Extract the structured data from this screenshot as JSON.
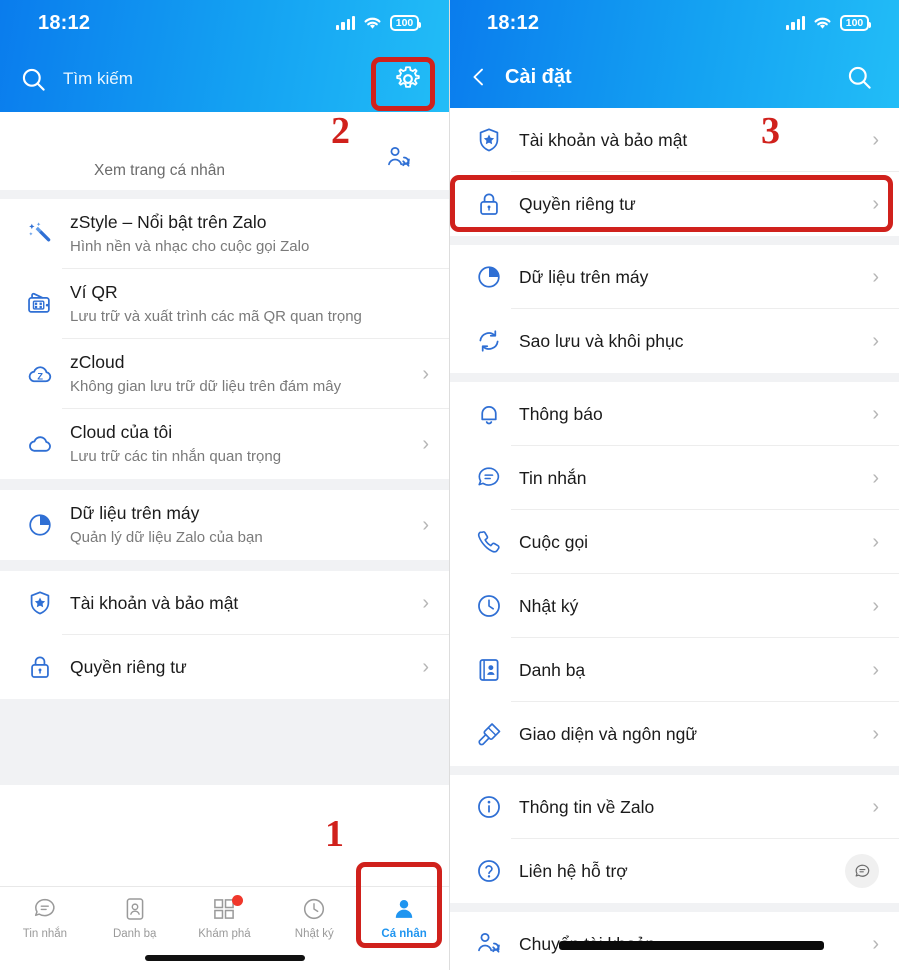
{
  "status_bar": {
    "time": "18:12",
    "battery": "100",
    "signal_icon": "signal-bars-icon",
    "wifi_icon": "wifi-icon"
  },
  "left_screen": {
    "search": {
      "placeholder": "Tìm kiếm",
      "search_icon": "search-icon",
      "settings_icon": "gear-icon"
    },
    "profile": {
      "subtitle": "Xem trang cá nhân",
      "switch_account_icon": "switch-account-icon"
    },
    "sections": [
      {
        "items": [
          {
            "icon": "magic-wand-icon",
            "title": "zStyle – Nổi bật trên Zalo",
            "subtitle": "Hình nền và nhạc cho cuộc gọi Zalo",
            "chevron": false
          },
          {
            "icon": "qr-wallet-icon",
            "title": "Ví QR",
            "subtitle": "Lưu trữ và xuất trình các mã QR quan trọng",
            "chevron": false
          },
          {
            "icon": "zcloud-icon",
            "title": "zCloud",
            "subtitle": "Không gian lưu trữ dữ liệu trên đám mây",
            "chevron": true
          },
          {
            "icon": "cloud-icon",
            "title": "Cloud của tôi",
            "subtitle": "Lưu trữ các tin nhắn quan trọng",
            "chevron": true
          }
        ]
      },
      {
        "items": [
          {
            "icon": "pie-chart-icon",
            "title": "Dữ liệu trên máy",
            "subtitle": "Quản lý dữ liệu Zalo của bạn",
            "chevron": true
          }
        ]
      },
      {
        "items": [
          {
            "icon": "shield-star-icon",
            "title": "Tài khoản và bảo mật",
            "subtitle": "",
            "chevron": true
          },
          {
            "icon": "lock-icon",
            "title": "Quyền riêng tư",
            "subtitle": "",
            "chevron": true
          }
        ]
      }
    ],
    "tabs": [
      {
        "icon": "chat-bubble-icon",
        "label": "Tin nhắn",
        "active": false,
        "badge": false
      },
      {
        "icon": "contacts-card-icon",
        "label": "Danh bạ",
        "active": false,
        "badge": false
      },
      {
        "icon": "grid-squares-icon",
        "label": "Khám phá",
        "active": false,
        "badge": true
      },
      {
        "icon": "clock-icon",
        "label": "Nhật ký",
        "active": false,
        "badge": false
      },
      {
        "icon": "person-icon",
        "label": "Cá nhân",
        "active": true,
        "badge": false
      }
    ]
  },
  "right_screen": {
    "header": {
      "back_icon": "chevron-left-icon",
      "title": "Cài đặt",
      "search_icon": "search-icon"
    },
    "sections": [
      {
        "items": [
          {
            "icon": "shield-star-icon",
            "title": "Tài khoản và bảo mật",
            "chevron": true
          },
          {
            "icon": "lock-icon",
            "title": "Quyền riêng tư",
            "chevron": true
          }
        ]
      },
      {
        "items": [
          {
            "icon": "pie-chart-icon",
            "title": "Dữ liệu trên máy",
            "chevron": true
          },
          {
            "icon": "sync-icon",
            "title": "Sao lưu và khôi phục",
            "chevron": true
          }
        ]
      },
      {
        "items": [
          {
            "icon": "bell-icon",
            "title": "Thông báo",
            "chevron": true
          },
          {
            "icon": "chat-bubble-icon",
            "title": "Tin nhắn",
            "chevron": true
          },
          {
            "icon": "phone-icon",
            "title": "Cuộc gọi",
            "chevron": true
          },
          {
            "icon": "clock-icon",
            "title": "Nhật ký",
            "chevron": true
          },
          {
            "icon": "contacts-book-icon",
            "title": "Danh bạ",
            "chevron": true
          },
          {
            "icon": "paint-roller-icon",
            "title": "Giao diện và ngôn ngữ",
            "chevron": true
          }
        ]
      },
      {
        "items": [
          {
            "icon": "info-circle-icon",
            "title": "Thông tin về Zalo",
            "chevron": true
          },
          {
            "icon": "question-circle-icon",
            "title": "Liên hệ hỗ trợ",
            "chevron": false,
            "trailing": "chat-bubble-round-icon"
          }
        ]
      },
      {
        "items": [
          {
            "icon": "switch-account-icon",
            "title": "Chuyển tài khoản",
            "chevron": true
          }
        ]
      }
    ]
  },
  "annotations": [
    {
      "number": "1",
      "target": "profile-tab"
    },
    {
      "number": "2",
      "target": "settings-gear"
    },
    {
      "number": "3",
      "target": "privacy-row"
    }
  ],
  "colors": {
    "header_gradient_start": "#0a7ced",
    "header_gradient_end": "#22bdf7",
    "accent_blue": "#1f95f0",
    "icon_blue": "#2d6fd0",
    "annotation_red": "#d0211c",
    "badge_red": "#f0372b"
  }
}
